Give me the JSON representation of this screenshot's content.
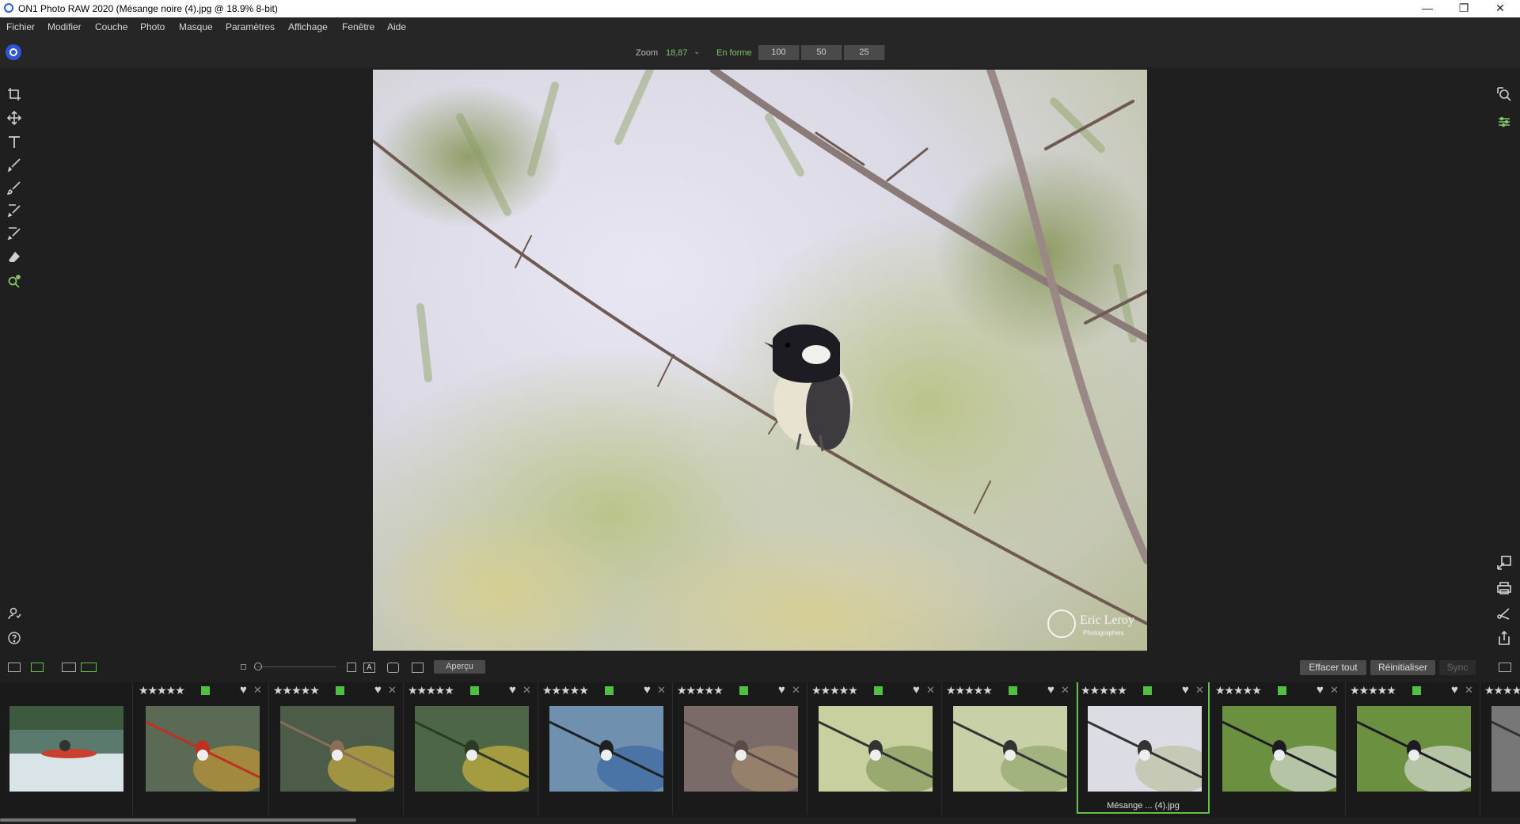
{
  "window": {
    "title": "ON1 Photo RAW 2020 (Mésange noire (4).jpg @ 18.9% 8-bit)",
    "minimize": "—",
    "restore": "❐",
    "close": "✕"
  },
  "menu": [
    "Fichier",
    "Modifier",
    "Couche",
    "Photo",
    "Masque",
    "Paramètres",
    "Affichage",
    "Fenêtre",
    "Aide"
  ],
  "zoom": {
    "label": "Zoom",
    "value": "18,87",
    "fit_label": "En forme",
    "presets": [
      "100",
      "50",
      "25"
    ]
  },
  "accent_color": "#5fc04a",
  "left_tools": [
    "crop-icon",
    "move-icon",
    "text-icon",
    "brush-icon",
    "masking-brush-icon",
    "retouch-brush-icon",
    "line-mask-icon",
    "eraser-icon",
    "zoom-tool-icon"
  ],
  "right_icons": [
    "zoom-view-icon",
    "adjustments-icon",
    "resize-icon",
    "print-icon",
    "send-icon",
    "export-icon"
  ],
  "image": {
    "watermark_name": "Eric Leroy",
    "watermark_sub": "Photographies"
  },
  "filmstrip_toolbar": {
    "apercu": "Aperçu",
    "effacer_tout": "Effacer tout",
    "reinitialiser": "Réinitialiser",
    "sync": "Sync"
  },
  "filmstrip": {
    "stars": "★★★★★",
    "heart": "♥",
    "reject": "✕",
    "selected_caption": "Mésange ... (4).jpg",
    "selected_index": 8
  }
}
